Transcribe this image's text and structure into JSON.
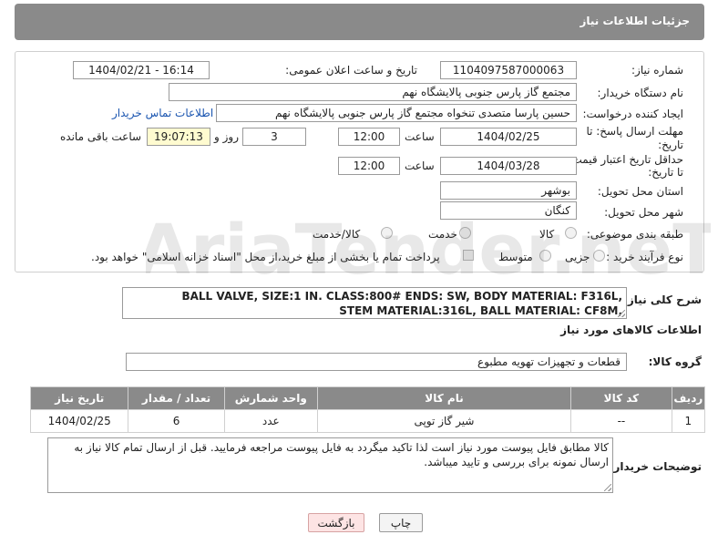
{
  "header": {
    "title": "جزئیات اطلاعات نیاز"
  },
  "form": {
    "need_number_label": "شماره نیاز:",
    "need_number": "1104097587000063",
    "announce_label": "تاریخ و ساعت اعلان عمومی:",
    "announce_value": "1404/02/21 - 16:14",
    "buyer_org_label": "نام دستگاه خریدار:",
    "buyer_org": "مجتمع گاز پارس جنوبی  پالایشگاه نهم",
    "creator_label": "ایجاد کننده درخواست:",
    "creator": "حسین پارسا متصدی تنخواه مجتمع گاز پارس جنوبی  پالایشگاه نهم",
    "contact_link": "اطلاعات تماس خریدار",
    "reply_deadline_label_1": "مهلت ارسال پاسخ: تا",
    "reply_deadline_label_2": "تاریخ:",
    "reply_date": "1404/02/25",
    "time_label": "ساعت",
    "reply_time": "12:00",
    "days_value": "3",
    "days_label": "روز و",
    "remaining_time": "19:07:13",
    "remaining_label": "ساعت باقی مانده",
    "price_validity_label_1": "حداقل تاریخ اعتبار قیمت:",
    "price_validity_label_2": "تا تاریخ:",
    "price_date": "1404/03/28",
    "price_time": "12:00",
    "province_label": "استان محل تحویل:",
    "province": "بوشهر",
    "city_label": "شهر محل تحویل:",
    "city": "کنگان",
    "category_label": "طبقه بندی موضوعی:",
    "category_options": [
      "کالا",
      "خدمت",
      "کالا/خدمت"
    ],
    "process_label": "نوع فرآیند خرید :",
    "process_options": [
      "جزیی",
      "متوسط"
    ],
    "payment_note": "پرداخت تمام یا بخشی از مبلغ خرید،از محل \"اسناد خزانه اسلامی\" خواهد بود."
  },
  "description": {
    "label": "شرح کلی نیاز:",
    "line1": "BALL VALVE, SIZE:1 IN. CLASS:800# ENDS: SW, BODY MATERIAL: F316L,",
    "line2": "STEM MATERIAL:316L, BALL MATERIAL: CF8M,"
  },
  "goods_section": {
    "title": "اطلاعات کالاهای مورد نیاز",
    "group_label": "گروه کالا:",
    "group_value": "قطعات و تجهیزات تهویه مطبوع"
  },
  "table": {
    "headers": [
      "ردیف",
      "کد کالا",
      "نام کالا",
      "واحد شمارش",
      "تعداد / مقدار",
      "تاریخ نیاز"
    ],
    "rows": [
      [
        "1",
        "--",
        "شیر گاز توپی",
        "عدد",
        "6",
        "1404/02/25"
      ]
    ]
  },
  "notes": {
    "label": "توضیحات خریدار:",
    "text": "کالا مطابق فایل پیوست مورد نیاز است لذا تاکید میگردد به فایل پیوست مراجعه فرمایید. قبل از ارسال تمام کالا نیاز به ارسال نمونه برای بررسی و تایید میباشد."
  },
  "buttons": {
    "print": "چاپ",
    "back": "بازگشت"
  },
  "watermark": {
    "text": "AriaTender.neT"
  }
}
